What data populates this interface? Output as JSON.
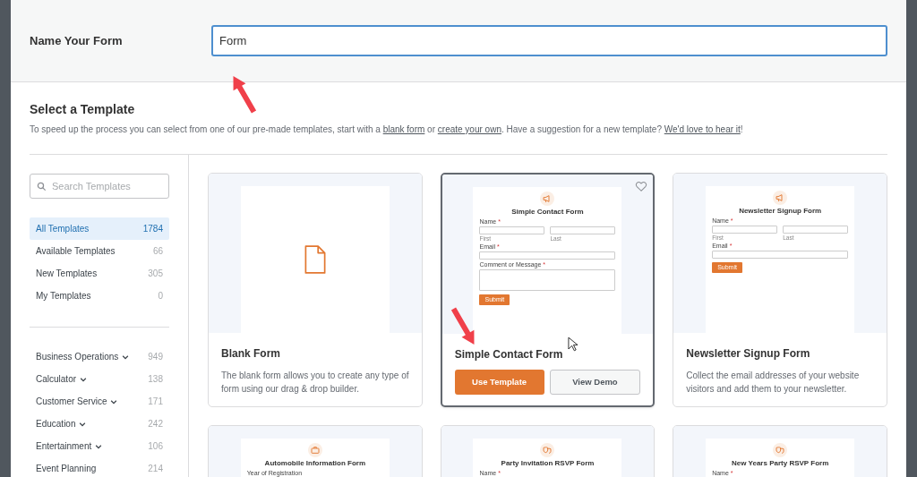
{
  "name_form": {
    "label": "Name Your Form",
    "value": "Form"
  },
  "section": {
    "title": "Select a Template",
    "description": [
      {
        "kind": "text",
        "text": "To speed up the process you can select from one of our pre-made templates, start with a "
      },
      {
        "kind": "link",
        "text": "blank form"
      },
      {
        "kind": "text",
        "text": " or "
      },
      {
        "kind": "link",
        "text": "create your own"
      },
      {
        "kind": "text",
        "text": ". Have a suggestion for a new template? "
      },
      {
        "kind": "link",
        "text": "We'd love to hear it"
      },
      {
        "kind": "text",
        "text": "!"
      }
    ]
  },
  "sidebar": {
    "search": {
      "placeholder": "Search Templates"
    },
    "filters": [
      {
        "label": "All Templates",
        "count": "1784",
        "selected": true
      },
      {
        "label": "Available Templates",
        "count": "66",
        "selected": false
      },
      {
        "label": "New Templates",
        "count": "305",
        "selected": false
      },
      {
        "label": "My Templates",
        "count": "0",
        "selected": false
      }
    ],
    "categories": [
      {
        "label": "Business Operations",
        "count": "949",
        "expandable": true
      },
      {
        "label": "Calculator",
        "count": "138",
        "expandable": true
      },
      {
        "label": "Customer Service",
        "count": "171",
        "expandable": true
      },
      {
        "label": "Education",
        "count": "242",
        "expandable": true
      },
      {
        "label": "Entertainment",
        "count": "106",
        "expandable": true
      },
      {
        "label": "Event Planning",
        "count": "214",
        "expandable": false
      }
    ]
  },
  "templates": [
    {
      "kind": "blank",
      "title": "Blank Form",
      "description": "The blank form allows you to create any type of form using our drag & drop builder.",
      "selected": false
    },
    {
      "kind": "form",
      "title": "Simple Contact Form",
      "selected": true,
      "actions": [
        "Use Template",
        "View Demo"
      ],
      "preview": {
        "title": "Simple Contact Form",
        "fields": [
          {
            "kind": "name",
            "label": "Name",
            "mark": "*",
            "sublabels": [
              "First",
              "Last"
            ]
          },
          {
            "kind": "text",
            "label": "Email",
            "mark": "*"
          },
          {
            "kind": "textarea",
            "label": "Comment or Message",
            "mark": "*"
          }
        ],
        "button": "Submit"
      }
    },
    {
      "kind": "form",
      "title": "Newsletter Signup Form",
      "description": "Collect the email addresses of your website visitors and add them to your newsletter.",
      "selected": false,
      "preview": {
        "title": "Newsletter Signup Form",
        "fields": [
          {
            "kind": "name",
            "label": "Name",
            "mark": "*",
            "sublabels": [
              "First",
              "Last"
            ]
          },
          {
            "kind": "text",
            "label": "Email",
            "mark": "*"
          }
        ],
        "button": "Submit"
      }
    },
    {
      "kind": "form",
      "selected": false,
      "preview": {
        "title": "Automobile Information Form",
        "fields": [
          {
            "kind": "text",
            "label": "Year of Registration"
          }
        ]
      }
    },
    {
      "kind": "form",
      "selected": false,
      "preview": {
        "title": "Party Invitation RSVP Form",
        "fields": [
          {
            "kind": "name",
            "label": "Name",
            "mark": "*"
          }
        ]
      }
    },
    {
      "kind": "form",
      "selected": false,
      "preview": {
        "title": "New Years Party RSVP Form",
        "fields": [
          {
            "kind": "name",
            "label": "Name",
            "mark": "*"
          }
        ]
      }
    }
  ]
}
